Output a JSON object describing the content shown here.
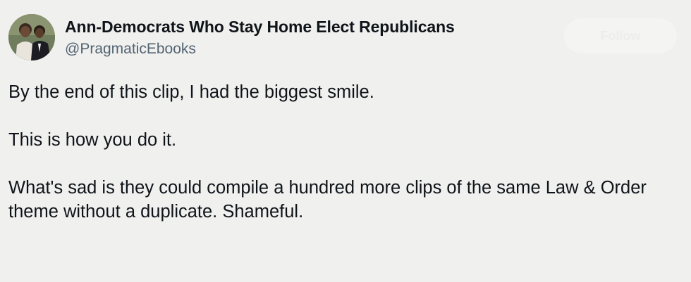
{
  "tweet": {
    "author": {
      "display_name": "Ann-Democrats Who Stay Home Elect Republicans",
      "handle": "@PragmaticEbooks"
    },
    "follow_label": "Follow",
    "paragraphs": [
      "By the end of this clip, I had the biggest smile.",
      "This is how you do it.",
      "What's sad is they could compile a hundred more clips of the same Law & Order theme without a duplicate. Shameful."
    ]
  },
  "colors": {
    "background": "#f0f0ef",
    "text": "#0f1419",
    "secondary_text": "#536471"
  }
}
